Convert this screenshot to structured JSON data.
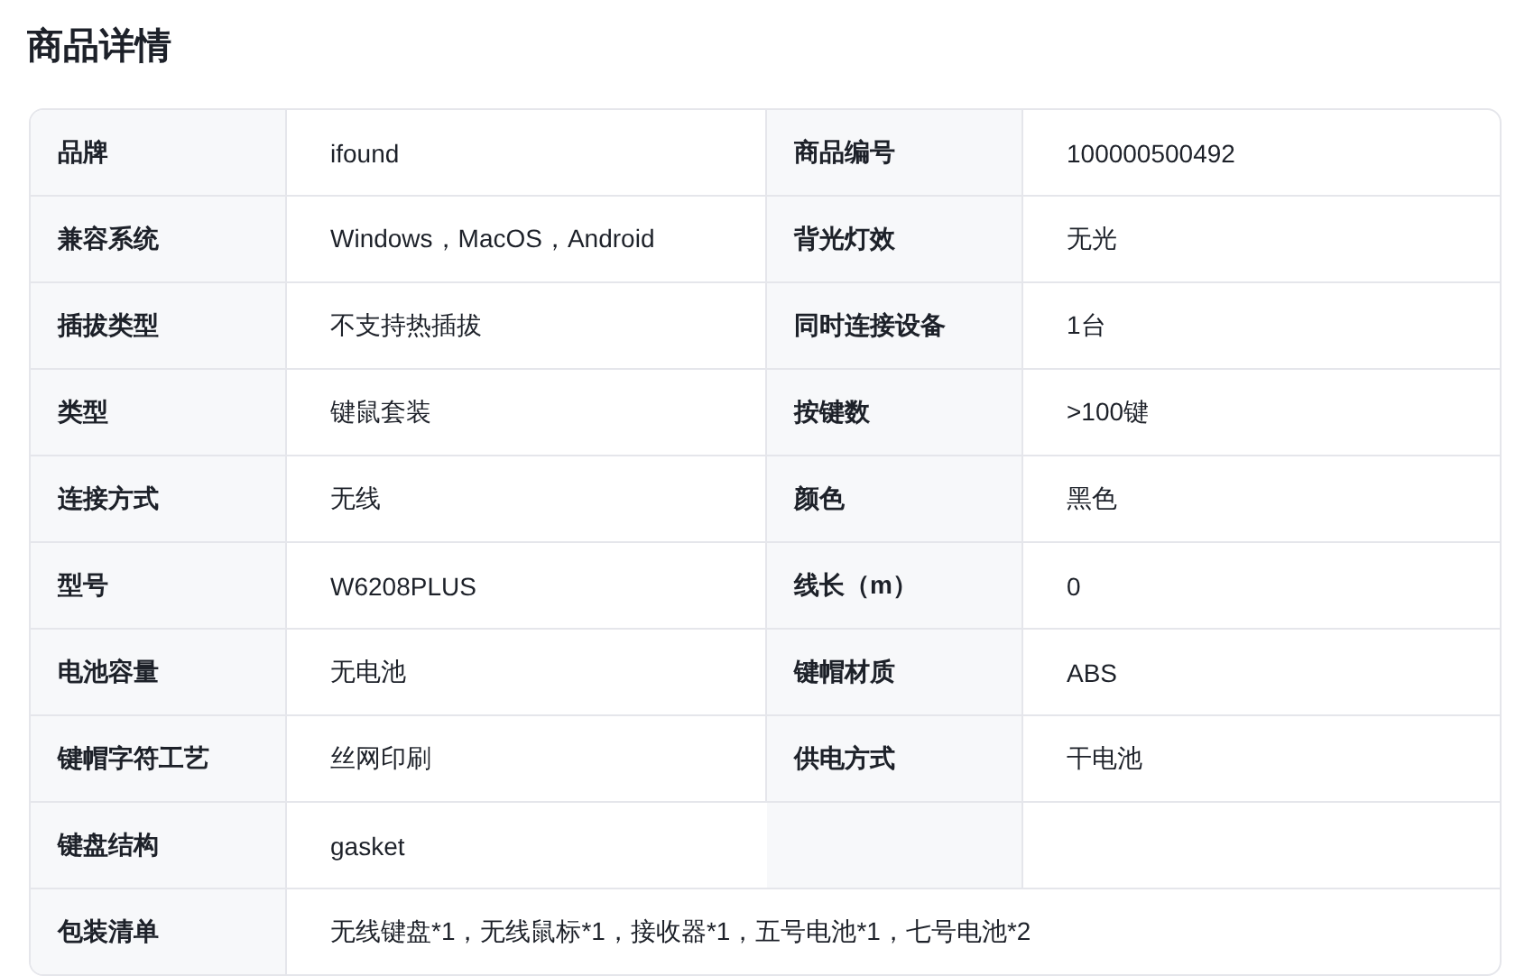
{
  "title": "商品详情",
  "rows": [
    {
      "pairs": [
        {
          "label": "品牌",
          "value": "ifound"
        },
        {
          "label": "商品编号",
          "value": "100000500492"
        }
      ]
    },
    {
      "pairs": [
        {
          "label": "兼容系统",
          "value": "Windows，MacOS，Android"
        },
        {
          "label": "背光灯效",
          "value": "无光"
        }
      ]
    },
    {
      "pairs": [
        {
          "label": "插拔类型",
          "value": "不支持热插拔"
        },
        {
          "label": "同时连接设备",
          "value": "1台"
        }
      ]
    },
    {
      "pairs": [
        {
          "label": "类型",
          "value": "键鼠套装"
        },
        {
          "label": "按键数",
          "value": ">100键"
        }
      ]
    },
    {
      "pairs": [
        {
          "label": "连接方式",
          "value": "无线"
        },
        {
          "label": "颜色",
          "value": "黑色"
        }
      ]
    },
    {
      "pairs": [
        {
          "label": "型号",
          "value": "W6208PLUS"
        },
        {
          "label": "线长（m）",
          "value": "0"
        }
      ]
    },
    {
      "pairs": [
        {
          "label": "电池容量",
          "value": "无电池"
        },
        {
          "label": "键帽材质",
          "value": "ABS"
        }
      ]
    },
    {
      "pairs": [
        {
          "label": "键帽字符工艺",
          "value": "丝网印刷"
        },
        {
          "label": "供电方式",
          "value": "干电池"
        }
      ]
    },
    {
      "pairs": [
        {
          "label": "键盘结构",
          "value": "gasket"
        }
      ]
    },
    {
      "pairs": [
        {
          "label": "包装清单",
          "value": "无线键盘*1，无线鼠标*1，接收器*1，五号电池*1，七号电池*2"
        }
      ]
    }
  ]
}
